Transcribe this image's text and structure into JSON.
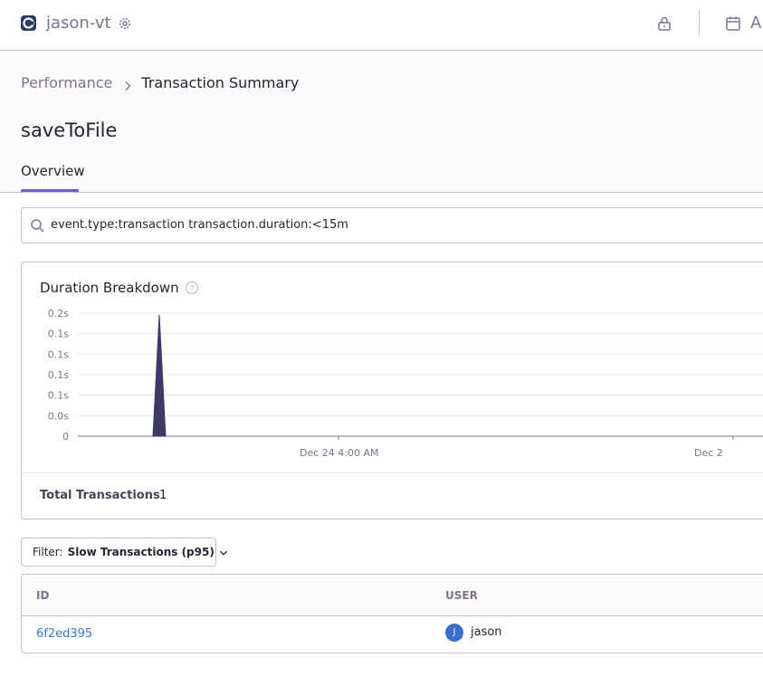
{
  "topbar": {
    "org_name": "jason-vt",
    "cut_label": "A"
  },
  "breadcrumb": {
    "parent": "Performance",
    "current": "Transaction Summary"
  },
  "page": {
    "title": "saveToFile",
    "tab_overview": "Overview"
  },
  "search": {
    "query": "event.type:transaction transaction.duration:<15m"
  },
  "panel": {
    "title": "Duration Breakdown",
    "total_label": "Total Transactions",
    "total_value": "1"
  },
  "chart_data": {
    "type": "area",
    "title": "Duration Breakdown",
    "y_tick_labels": [
      "0.2s",
      "0.1s",
      "0.1s",
      "0.1s",
      "0.1s",
      "0.0s",
      "0"
    ],
    "x_tick_labels": [
      "Dec 24 4:00 AM",
      "Dec 2"
    ],
    "series": [
      {
        "values": [
          0,
          0,
          0.2,
          0,
          0
        ],
        "color": "#3e3a66"
      }
    ],
    "ylim": [
      0,
      0.2
    ],
    "grid": true
  },
  "filter": {
    "prefix": "Filter:",
    "value": "Slow Transactions (p95)"
  },
  "table": {
    "headers": {
      "id": "ID",
      "user": "USER"
    },
    "rows": [
      {
        "id": "6f2ed395",
        "avatar_letter": "J",
        "user": "jason"
      }
    ]
  },
  "colors": {
    "accent": "#6c5fc7",
    "link": "#3d74db",
    "chart_fill": "#3e3a66"
  }
}
